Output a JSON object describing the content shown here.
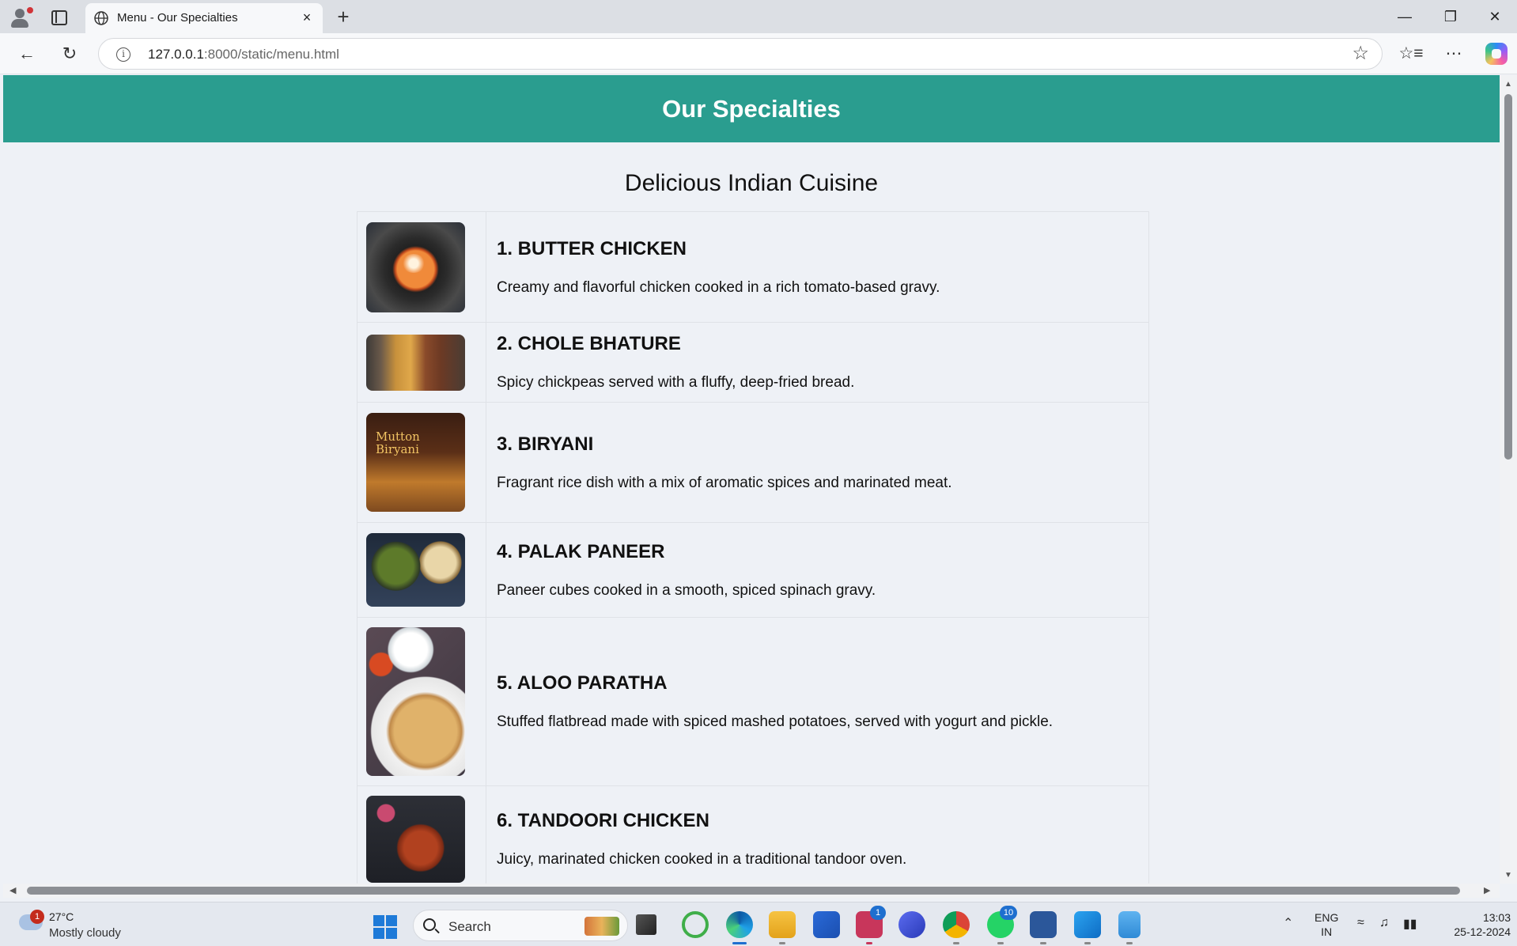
{
  "browser": {
    "tab_title": "Menu - Our Specialties",
    "tab_close": "×",
    "new_tab": "+",
    "url_host": "127.0.0.1",
    "url_rest": ":8000/static/menu.html",
    "window_controls": [
      "—",
      "❐",
      "✕"
    ],
    "icons": [
      "profile-icon",
      "tab-actions-icon",
      "globe-icon",
      "back-arrow-icon",
      "reload-icon",
      "info-icon",
      "star-icon",
      "favorites-icon",
      "more-icon",
      "copilot-icon"
    ]
  },
  "page": {
    "header_title": "Our Specialties",
    "section_title": "Delicious Indian Cuisine",
    "accent_color": "#2a9d8f",
    "items": [
      {
        "name": "1. BUTTER CHICKEN",
        "description": "Creamy and flavorful chicken cooked in a rich tomato-based gravy."
      },
      {
        "name": "2. CHOLE BHATURE",
        "description": "Spicy chickpeas served with a fluffy, deep-fried bread."
      },
      {
        "name": "3. BIRYANI",
        "description": "Fragrant rice dish with a mix of aromatic spices and marinated meat.",
        "image_text": "Mutton Biryani"
      },
      {
        "name": "4. PALAK PANEER",
        "description": "Paneer cubes cooked in a smooth, spiced spinach gravy."
      },
      {
        "name": "5. ALOO PARATHA",
        "description": "Stuffed flatbread made with spiced mashed potatoes, served with yogurt and pickle."
      },
      {
        "name": "6. TANDOORI CHICKEN",
        "description": "Juicy, marinated chicken cooked in a traditional tandoor oven."
      }
    ]
  },
  "taskbar": {
    "weather_badge": "1",
    "weather_temp": "27°C",
    "weather_desc": "Mostly cloudy",
    "search_label": "Search",
    "app_badges": {
      "lens": "1",
      "whatsapp": "10"
    },
    "lang_line1": "ENG",
    "lang_line2": "IN",
    "time": "13:03",
    "date": "25-12-2024"
  }
}
